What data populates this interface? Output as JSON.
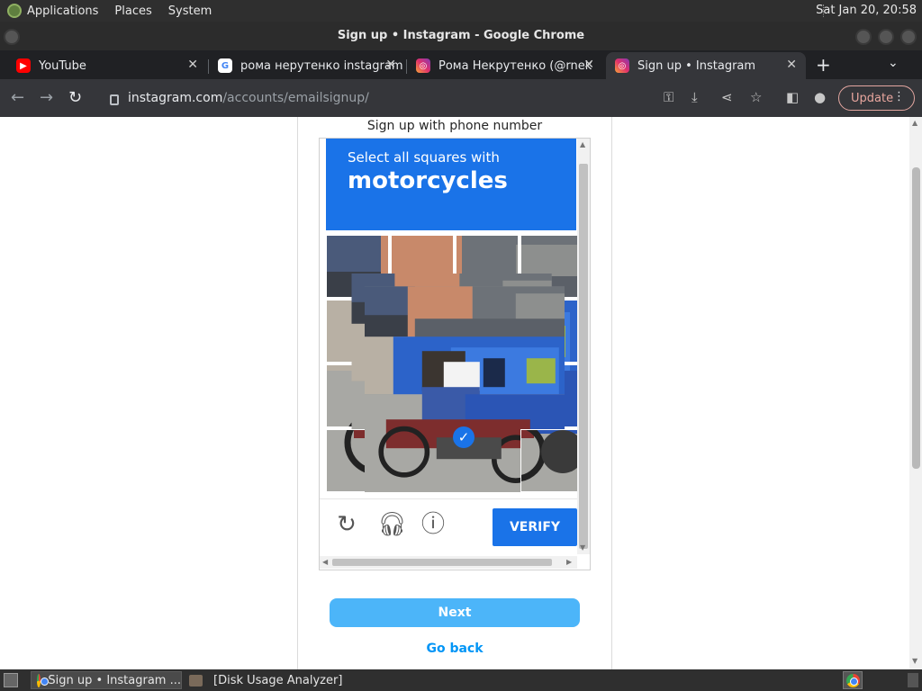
{
  "system_bar": {
    "menu": [
      "Applications",
      "Places",
      "System"
    ],
    "clock": "Sat Jan 20, 20:58"
  },
  "window": {
    "title": "Sign up • Instagram - Google Chrome"
  },
  "tabs": [
    {
      "label": "YouTube",
      "icon": "youtube-icon"
    },
    {
      "label": "рома нерутенко instagram",
      "icon": "google-icon"
    },
    {
      "label": "Рома Некрутенко (@rnek",
      "icon": "instagram-icon"
    },
    {
      "label": "Sign up • Instagram",
      "icon": "instagram-icon",
      "active": true
    }
  ],
  "toolbar": {
    "url_host": "instagram.com",
    "url_path": "/accounts/emailsignup/",
    "update_label": "Update"
  },
  "page": {
    "heading": "Sign up with phone number",
    "next_label": "Next",
    "go_back_label": "Go back"
  },
  "captcha": {
    "prompt": "Select all squares with",
    "target": "motorcycles",
    "verify_label": "VERIFY",
    "grid": {
      "rows": 4,
      "cols": 4,
      "selected": [
        [
          2,
          1
        ],
        [
          3,
          2
        ]
      ]
    },
    "icons": [
      "reload-icon",
      "headphones-icon",
      "info-icon"
    ]
  },
  "taskbar": {
    "items": [
      "Sign up • Instagram ...",
      "[Disk Usage Analyzer]"
    ]
  },
  "colors": {
    "captcha_blue": "#1a73e8",
    "next_button": "#4cb5f9",
    "link_blue": "#0095f6",
    "update_outline": "#e3a6a0"
  }
}
